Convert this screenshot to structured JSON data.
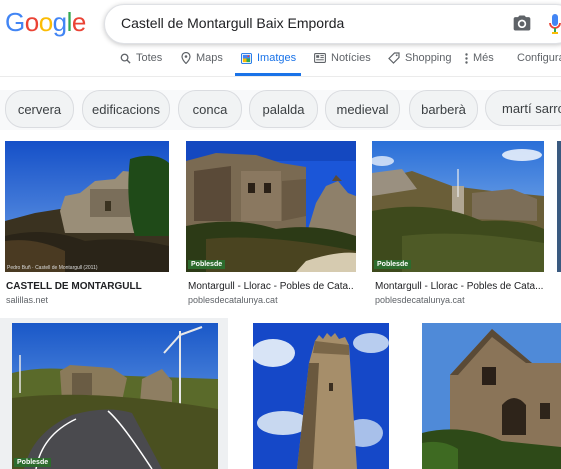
{
  "logo": {
    "letters": [
      "G",
      "o",
      "o",
      "g",
      "l",
      "e"
    ],
    "colors": [
      "#4285f4",
      "#ea4335",
      "#fbbc05",
      "#4285f4",
      "#34a853",
      "#ea4335"
    ]
  },
  "search": {
    "query": "Castell de Montargull Baix Emporda",
    "camera_icon": "camera-icon",
    "mic_icon": "mic-icon"
  },
  "tabs": {
    "all": "Totes",
    "maps": "Maps",
    "images": "Imatges",
    "news": "Notícies",
    "shopping": "Shopping",
    "more": "Més",
    "settings": "Configura"
  },
  "chips": [
    "cervera",
    "edificacions",
    "conca",
    "palalda",
    "medieval",
    "barberà",
    "martí sarroca"
  ],
  "results": [
    {
      "caption": "CASTELL DE MONTARGULL",
      "source": "salillas.net",
      "watermark": "Pedro Buñ · Castell de Montargull (2011)"
    },
    {
      "caption": "Montargull - Llorac - Pobles de Cata...",
      "source": "poblesdecatalunya.cat",
      "watermark": "Poblesde"
    },
    {
      "caption": "Montargull - Llorac - Pobles de Cata...",
      "source": "poblesdecatalunya.cat",
      "watermark": "Poblesde"
    },
    {
      "watermark": "Poblesde"
    }
  ],
  "colors": {
    "accent": "#1a73e8",
    "tab_text": "#5f6368",
    "chip_bg": "#f1f3f4"
  }
}
